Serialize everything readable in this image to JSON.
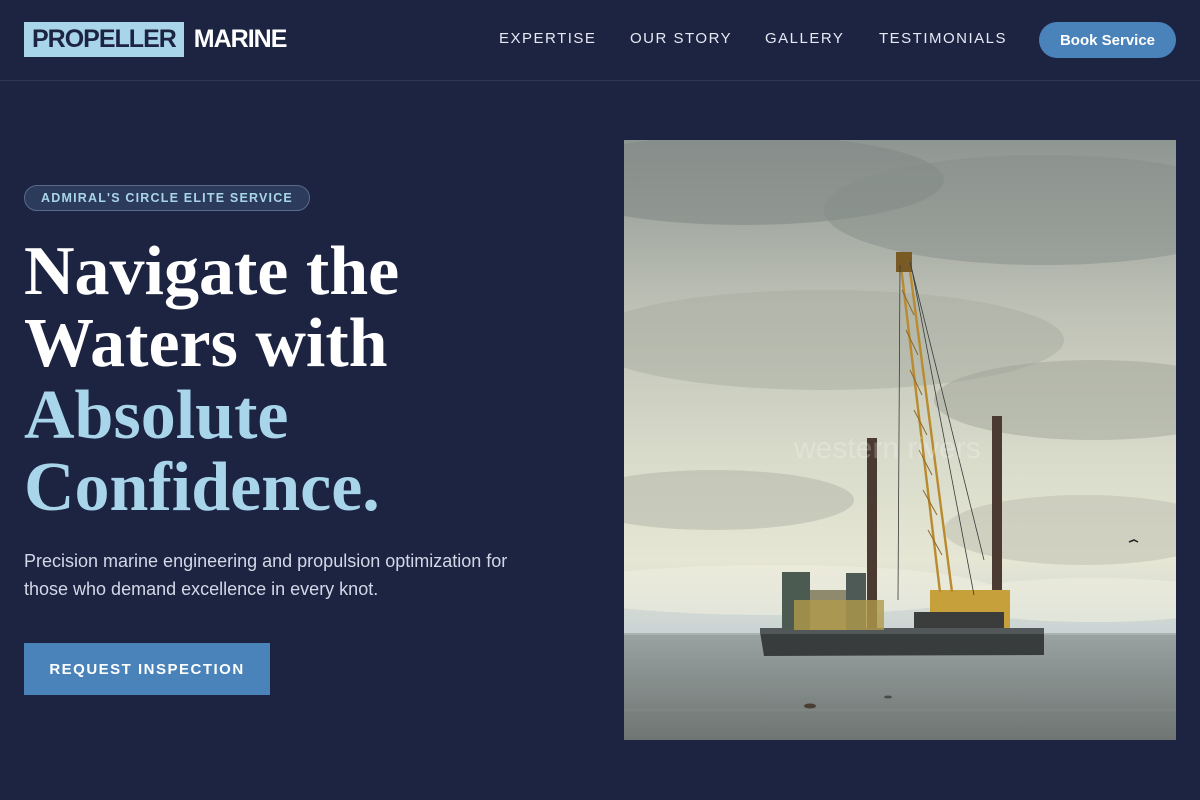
{
  "header": {
    "logo_box": "PROPELLER",
    "logo_text": "MARINE",
    "nav": [
      "EXPERTISE",
      "OUR STORY",
      "GALLERY",
      "TESTIMONIALS"
    ],
    "book_label": "Book Service"
  },
  "hero": {
    "badge": "ADMIRAL'S CIRCLE ELITE SERVICE",
    "headline_lines": [
      "Navigate the",
      "Waters with",
      "Absolute",
      "Confidence."
    ],
    "subtext": "Precision marine engineering and propulsion optimization for those who demand excellence in every knot.",
    "cta_label": "REQUEST INSPECTION",
    "photo_watermark": "western rivers"
  },
  "colors": {
    "background": "#1c2442",
    "accent": "#a9d5ea",
    "button": "#4a83ba"
  }
}
